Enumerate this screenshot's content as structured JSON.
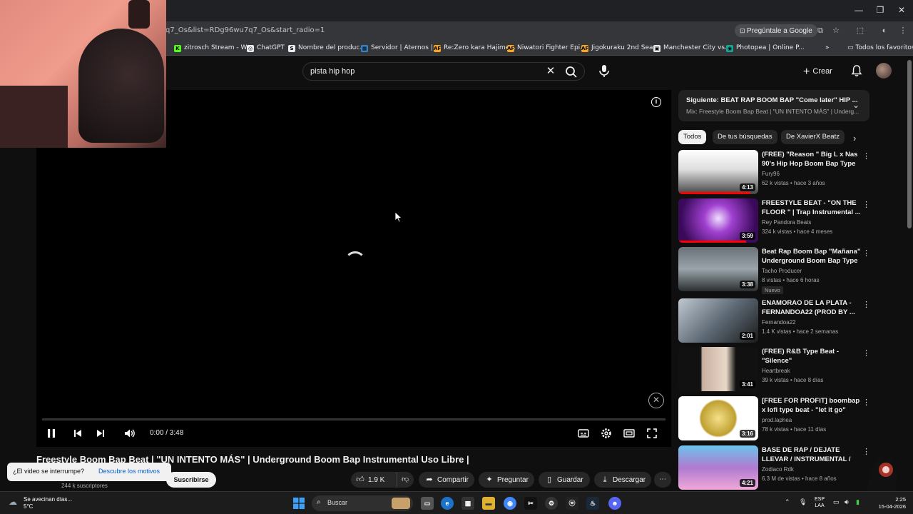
{
  "browser": {
    "url": "q7_Os&list=RDg96wu7q7_Os&start_radio=1",
    "ask_google": "Pregúntale a Google",
    "bookmarks": [
      {
        "label": "zitrosch Stream - W...",
        "color": "#53fc18",
        "letter": "K"
      },
      {
        "label": "ChatGPT",
        "color": "#e8eaed",
        "letter": "◎"
      },
      {
        "label": "Nombre del produc...",
        "color": "#e8eaed",
        "letter": "S"
      },
      {
        "label": "Servidor | Aternos |...",
        "color": "#3b82c4",
        "letter": "▦"
      },
      {
        "label": "Re:Zero kara Hajime...",
        "color": "#f5a623",
        "letter": "AF"
      },
      {
        "label": "Niwatori Fighter Epi...",
        "color": "#f5a623",
        "letter": "AF"
      },
      {
        "label": "Jigokuraku 2nd Sea...",
        "color": "#f5a623",
        "letter": "AF"
      },
      {
        "label": "Manchester City vs...",
        "color": "#e8eaed",
        "letter": "▣"
      },
      {
        "label": "Photopea | Online P...",
        "color": "#18a497",
        "letter": "◉"
      }
    ],
    "all_favorites": "Todos los favoritos"
  },
  "header": {
    "search_value": "pista hip hop",
    "create_label": "Crear"
  },
  "player": {
    "time": "0:00 / 3:48"
  },
  "video": {
    "title": "Freestyle Boom Bap Beat | \"UN INTENTO MÁS\" | Underground Boom Bap Instrumental Uso Libre |",
    "subscribers": "244 k suscriptores",
    "subscribe": "Suscribirse",
    "interrupt_question": "¿El video se interrumpe?",
    "interrupt_link": "Descubre los motivos",
    "likes": "1.9 K",
    "share": "Compartir",
    "ask": "Preguntar",
    "save": "Guardar",
    "download": "Descargar"
  },
  "sidebar": {
    "next_title": "Siguiente: BEAT RAP BOOM BAP \"Come later\" HIP ...",
    "next_sub": "Mix: Freestyle Boom Bap Beat | \"UN INTENTO MÁS\" | Underg...",
    "chips": [
      "Todos",
      "De tus búsquedas",
      "De XavierX Beatz"
    ],
    "items": [
      {
        "title": "(FREE) \"Reason \" Big L x Nas 90's Hip Hop Boom Bap Type ...",
        "channel": "Fury96",
        "meta": "62 k vistas • hace 3 años",
        "duration": "4:13",
        "badge": "",
        "watched": 0.9
      },
      {
        "title": "FREESTYLE BEAT - \"ON THE FLOOR \" | Trap Instrumental ...",
        "channel": "Rey Pandora Beats",
        "meta": "324 k vistas • hace 4 meses",
        "duration": "3:59",
        "badge": "",
        "watched": 0.85
      },
      {
        "title": "Beat Rap Boom Bap \"Mañana\" Underground Boom Bap Type ...",
        "channel": "Tacho Producer",
        "meta": "8 vistas • hace 6 horas",
        "duration": "3:38",
        "badge": "Nuevo",
        "watched": 0
      },
      {
        "title": "ENAMORAO DE LA PLATA - FERNANDOA22 (PROD BY ...",
        "channel": "Fernandoa22",
        "meta": "1.4 K vistas • hace 2 semanas",
        "duration": "2:01",
        "badge": "",
        "watched": 0
      },
      {
        "title": "(FREE) R&B Type Beat - \"Silence\"",
        "channel": "Heartbreak",
        "meta": "39 k vistas • hace 8 días",
        "duration": "3:41",
        "badge": "",
        "watched": 0
      },
      {
        "title": "[FREE FOR PROFIT] boombap x lofi type beat - \"let it go\"",
        "channel": "prod.laphea",
        "meta": "78 k vistas • hace 11 días",
        "duration": "3:16",
        "badge": "",
        "watched": 0
      },
      {
        "title": "BASE DE RAP / DEJATE LLEVAR / INSTRUMENTAL / USO LIBRE",
        "channel": "Zodiaco Rdk",
        "meta": "6.3 M de vistas • hace 8 años",
        "duration": "4:21",
        "badge": "",
        "watched": 0
      }
    ]
  },
  "taskbar": {
    "weather_line1": "Se avecinan días...",
    "weather_line2": "5°C",
    "search": "Buscar",
    "lang1": "ESP",
    "lang2": "LAA",
    "time": "2:25",
    "date": "15-04-2026"
  }
}
